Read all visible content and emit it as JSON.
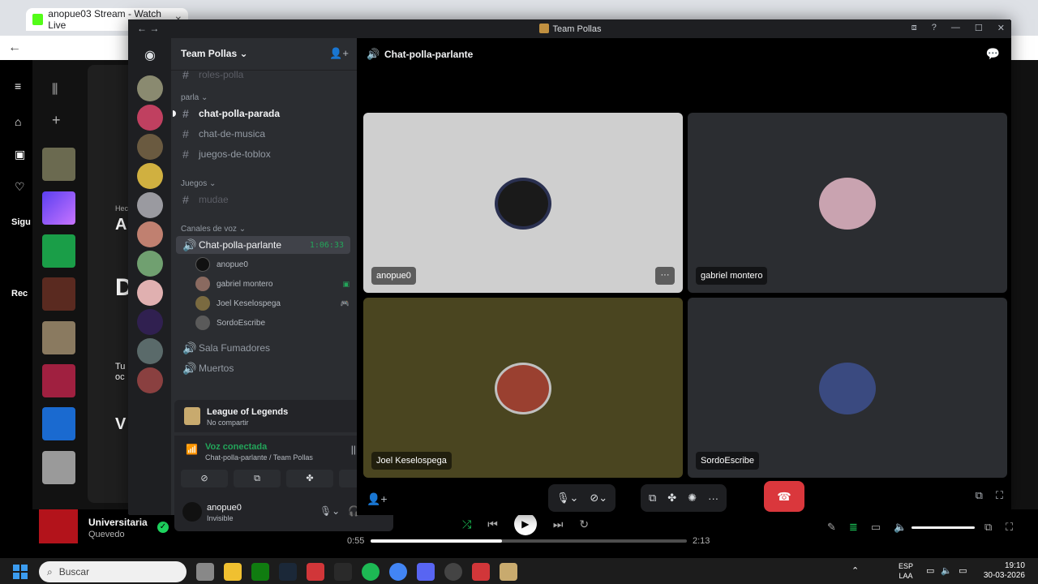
{
  "browser": {
    "tab_title": "anopue03 Stream - Watch Live",
    "close_glyph": "✕",
    "back_glyph": "←"
  },
  "spotify": {
    "library_labels": [
      "Sigu",
      "Rec"
    ],
    "side_text": [
      "Hec",
      "A",
      "D",
      "Tu oc",
      "V"
    ],
    "track_title": "Universitaria",
    "track_artist": "Quevedo",
    "time_current": "0:55",
    "time_total": "2:13",
    "progress": 0.415
  },
  "discord": {
    "window_title": "Team Pollas",
    "guild_name": "Team Pollas",
    "top_partial_channel": "roles-polla",
    "categories": {
      "parla": "parla",
      "juegos": "Juegos",
      "voz": "Canales de voz"
    },
    "text_channels": [
      {
        "name": "chat-polla-parada",
        "state": "unread"
      },
      {
        "name": "chat-de-musica",
        "state": "normal"
      },
      {
        "name": "juegos-de-toblox",
        "state": "normal"
      },
      {
        "name": "mudae",
        "state": "muted"
      }
    ],
    "voice_channels": {
      "active": {
        "name": "Chat-polla-parlante",
        "timer": "1:06:33"
      },
      "others": [
        "Sala Fumadores",
        "Muertos"
      ]
    },
    "voice_users": [
      {
        "name": "anopue0",
        "color": "#111111"
      },
      {
        "name": "gabriel montero",
        "color": "#8a6a60"
      },
      {
        "name": "Joel Keselospega",
        "color": "#7a6a40"
      },
      {
        "name": "SordoEscribe",
        "color": "#5a5a5a"
      }
    ],
    "activity": {
      "title": "League of Legends",
      "subtitle": "No compartir"
    },
    "voice_status": {
      "label": "Voz conectada",
      "channel": "Chat-polla-parlante / Team Pollas"
    },
    "user": {
      "name": "anopue0",
      "status": "Invisible"
    },
    "stage": {
      "title": "Chat-polla-parlante",
      "tiles": [
        {
          "name": "anopue0",
          "bg": "#cfcfcf",
          "avatar": "#1a1a1a",
          "more": "···"
        },
        {
          "name": "gabriel montero",
          "bg": "#2b2d31",
          "avatar": "#c9a3b0"
        },
        {
          "name": "Joel Keselospega",
          "bg": "#4a4520",
          "avatar": "#9a4030"
        },
        {
          "name": "SordoEscribe",
          "bg": "#2b2d31",
          "avatar": "#3a4a80"
        }
      ]
    },
    "accent_colors": {
      "green": "#23a55a",
      "red": "#da373c",
      "blurple": "#5865f2"
    }
  },
  "taskbar": {
    "search_placeholder": "Buscar",
    "lang_1": "ESP",
    "lang_2": "LAA",
    "time": "19:10",
    "date": "30-03-2026"
  }
}
